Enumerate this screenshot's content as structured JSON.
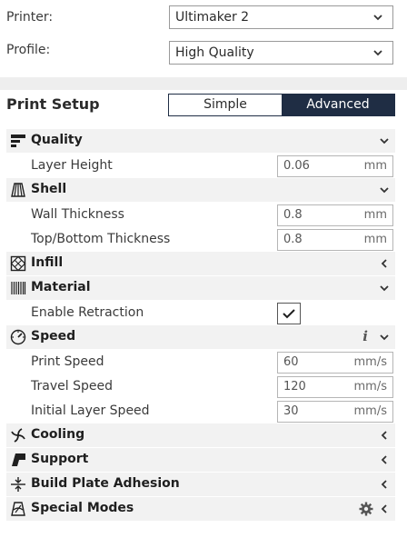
{
  "printer": {
    "label": "Printer:",
    "value": "Ultimaker 2"
  },
  "profile": {
    "label": "Profile:",
    "value": "High Quality"
  },
  "print_setup": {
    "title": "Print Setup",
    "mode_simple": "Simple",
    "mode_advanced": "Advanced",
    "selected_mode": "Advanced"
  },
  "categories": {
    "quality": {
      "label": "Quality",
      "icon": "quality-icon",
      "expanded": true
    },
    "shell": {
      "label": "Shell",
      "icon": "shell-icon",
      "expanded": true
    },
    "infill": {
      "label": "Infill",
      "icon": "infill-icon",
      "expanded": false
    },
    "material": {
      "label": "Material",
      "icon": "material-icon",
      "expanded": true
    },
    "speed": {
      "label": "Speed",
      "icon": "speed-icon",
      "expanded": true
    },
    "cooling": {
      "label": "Cooling",
      "icon": "cooling-icon",
      "expanded": false
    },
    "support": {
      "label": "Support",
      "icon": "support-icon",
      "expanded": false
    },
    "adhesion": {
      "label": "Build Plate Adhesion",
      "icon": "adhesion-icon",
      "expanded": false
    },
    "special": {
      "label": "Special Modes",
      "icon": "special-modes-icon",
      "expanded": false
    }
  },
  "settings": {
    "layer_height": {
      "label": "Layer Height",
      "value": "0.06",
      "unit": "mm"
    },
    "wall_thickness": {
      "label": "Wall Thickness",
      "value": "0.8",
      "unit": "mm"
    },
    "top_bottom_thickness": {
      "label": "Top/Bottom Thickness",
      "value": "0.8",
      "unit": "mm"
    },
    "enable_retraction": {
      "label": "Enable Retraction",
      "checked": true
    },
    "print_speed": {
      "label": "Print Speed",
      "value": "60",
      "unit": "mm/s"
    },
    "travel_speed": {
      "label": "Travel Speed",
      "value": "120",
      "unit": "mm/s"
    },
    "initial_layer_speed": {
      "label": "Initial Layer Speed",
      "value": "30",
      "unit": "mm/s"
    }
  },
  "colors": {
    "accent": "#1f2d44",
    "category_bg": "#f2f2f2",
    "separator": "#eeeeee"
  }
}
